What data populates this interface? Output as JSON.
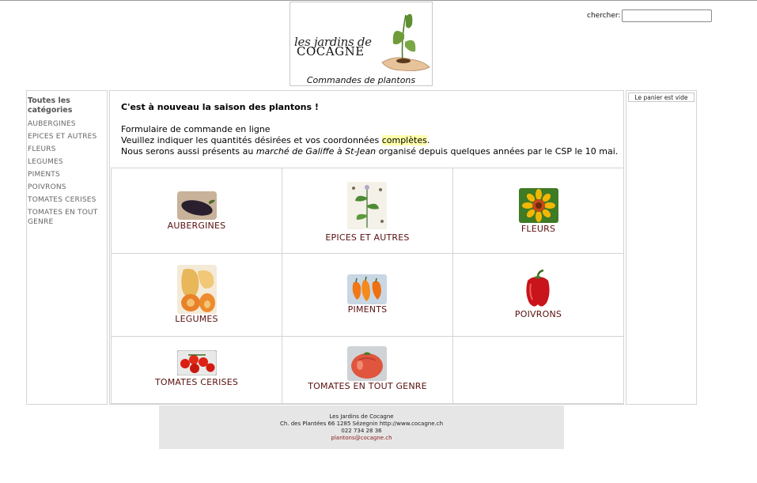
{
  "header": {
    "logo_line1": "les jardins de",
    "logo_line2": "COCAGNE",
    "caption": "Commandes de plantons"
  },
  "search": {
    "label": "chercher:",
    "value": "",
    "placeholder": ""
  },
  "sidebar": {
    "title": "Toutes les catégories",
    "items": [
      {
        "label": "AUBERGINES"
      },
      {
        "label": "EPICES ET AUTRES"
      },
      {
        "label": "FLEURS"
      },
      {
        "label": "LEGUMES"
      },
      {
        "label": "PIMENTS"
      },
      {
        "label": "POIVRONS"
      },
      {
        "label": "TOMATES CERISES"
      },
      {
        "label": "TOMATES EN TOUT GENRE"
      }
    ]
  },
  "intro": {
    "title": "C'est à nouveau la saison des plantons !",
    "line1": "Formulaire de commande en ligne",
    "line2_pre": "Veuillez indiquer les quantités désirées et vos coordonnées ",
    "line2_highlight": "complètes",
    "line2_post": ".",
    "line3_pre": "Nous serons aussi présents au ",
    "line3_italic": "marché de Galiffe à St-Jean",
    "line3_post": " organisé depuis quelques années par le CSP le 10 mai."
  },
  "categories": [
    {
      "label": "AUBERGINES",
      "icon": "eggplant-icon"
    },
    {
      "label": "EPICES ET AUTRES",
      "icon": "herb-illustration-icon"
    },
    {
      "label": "FLEURS",
      "icon": "sunflower-icon"
    },
    {
      "label": "LEGUMES",
      "icon": "butternut-squash-icon"
    },
    {
      "label": "PIMENTS",
      "icon": "chili-peppers-icon"
    },
    {
      "label": "POIVRONS",
      "icon": "red-pepper-icon"
    },
    {
      "label": "TOMATES CERISES",
      "icon": "cherry-tomatoes-icon"
    },
    {
      "label": "TOMATES EN TOUT GENRE",
      "icon": "tomato-icon"
    }
  ],
  "cart": {
    "status": "Le panier est vide"
  },
  "footer": {
    "name": "Les Jardins de Cocagne",
    "address": "Ch. des Plantées 66 1285 Sézegnin http://www.cocagne.ch",
    "phone": "022 734 28 36",
    "email": "plantons@cocagne.ch"
  },
  "colors": {
    "category_label": "#5a0f0f",
    "sidebar_text": "#666666",
    "highlight": "#ffffaa",
    "footer_bg": "#e6e6e6",
    "border": "#d4d4d4"
  }
}
